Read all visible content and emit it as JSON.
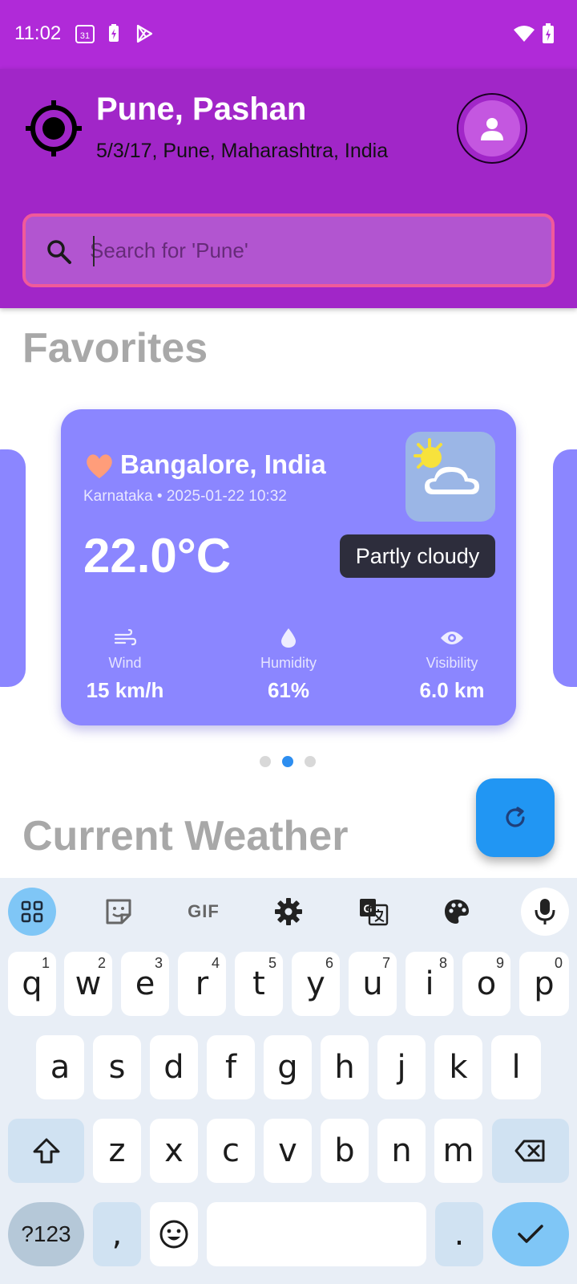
{
  "status_bar": {
    "time": "11:02",
    "calendar_badge": "31",
    "icons": [
      "calendar-icon",
      "battery-saver-icon",
      "play-store-icon",
      "wifi-icon",
      "battery-charging-icon"
    ]
  },
  "header": {
    "location_title": "Pune, Pashan",
    "location_subtitle": "5/3/17, Pune, Maharashtra, India",
    "search_placeholder": "Search for 'Pune'",
    "search_value": ""
  },
  "favorites": {
    "title": "Favorites",
    "card": {
      "city": "Bangalore, India",
      "meta": "Karnataka • 2025-01-22 10:32",
      "temperature": "22.0°C",
      "condition": "Partly cloudy",
      "stats": [
        {
          "label": "Wind",
          "value": "15 km/h",
          "icon": "wind-icon"
        },
        {
          "label": "Humidity",
          "value": "61%",
          "icon": "droplet-icon"
        },
        {
          "label": "Visibility",
          "value": "6.0 km",
          "icon": "eye-icon"
        }
      ]
    },
    "pagination": {
      "count": 3,
      "active_index": 1
    }
  },
  "current_weather": {
    "title": "Current Weather"
  },
  "colors": {
    "header": "#a126c8",
    "status_bar": "#b02ad8",
    "card": "#8b86ff",
    "fab": "#2196f3",
    "search_border": "#f05a9a"
  },
  "keyboard": {
    "toolbar": [
      "apps-grid-icon",
      "sticker-icon",
      "GIF",
      "gear-icon",
      "translate-icon",
      "palette-icon",
      "mic-icon"
    ],
    "row1": [
      {
        "k": "q",
        "n": "1"
      },
      {
        "k": "w",
        "n": "2"
      },
      {
        "k": "e",
        "n": "3"
      },
      {
        "k": "r",
        "n": "4"
      },
      {
        "k": "t",
        "n": "5"
      },
      {
        "k": "y",
        "n": "6"
      },
      {
        "k": "u",
        "n": "7"
      },
      {
        "k": "i",
        "n": "8"
      },
      {
        "k": "o",
        "n": "9"
      },
      {
        "k": "p",
        "n": "0"
      }
    ],
    "row2": [
      "a",
      "s",
      "d",
      "f",
      "g",
      "h",
      "j",
      "k",
      "l"
    ],
    "row3": [
      "z",
      "x",
      "c",
      "v",
      "b",
      "n",
      "m"
    ],
    "row4": {
      "symbols": "?123",
      "comma": ",",
      "period": "."
    }
  }
}
